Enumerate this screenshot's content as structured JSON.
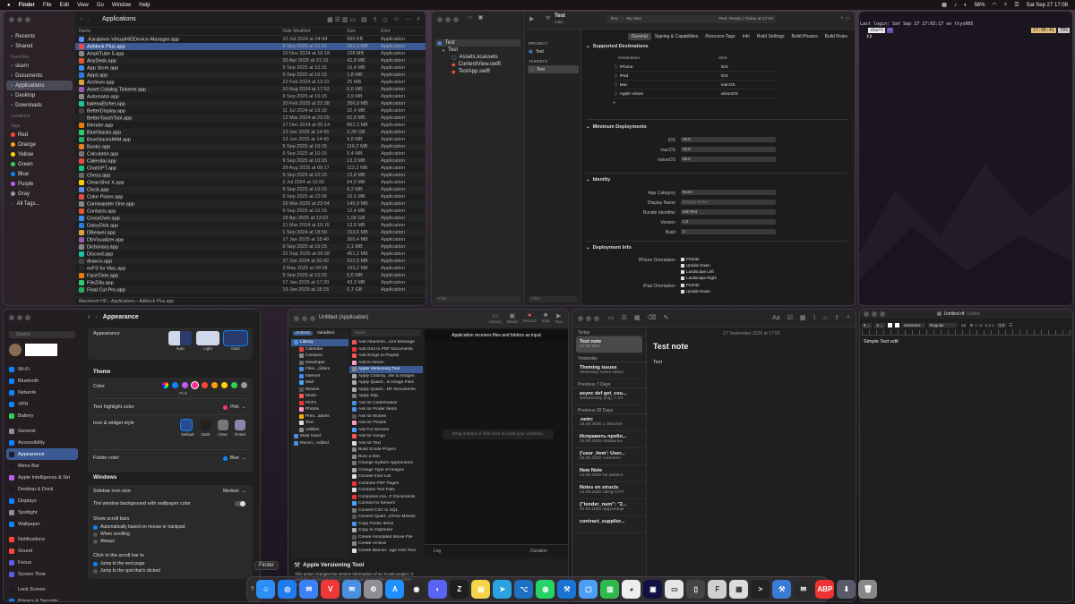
{
  "menubar": {
    "apple": "",
    "app": "Finder",
    "items": [
      "File",
      "Edit",
      "View",
      "Go",
      "Window",
      "Help"
    ],
    "battery": "56%",
    "clock": "Sat Sep 27  17:08"
  },
  "finder": {
    "title": "Applications",
    "sidebar": [
      {
        "h": "",
        "items": [
          {
            "label": "Recents",
            "icon": "clock-icon"
          },
          {
            "label": "Shared",
            "icon": "folder-shared-icon"
          }
        ]
      },
      {
        "h": "Favorites",
        "items": [
          {
            "label": "skarn",
            "icon": "home-icon"
          },
          {
            "label": "Documents",
            "icon": "document-icon"
          },
          {
            "label": "Applications",
            "icon": "apps-icon",
            "sel": true
          },
          {
            "label": "Desktop",
            "icon": "desktop-icon"
          },
          {
            "label": "Downloads",
            "icon": "download-icon"
          }
        ]
      },
      {
        "h": "Locations",
        "items": []
      },
      {
        "h": "Tags",
        "items": [
          {
            "label": "Red",
            "color": "#ff453a"
          },
          {
            "label": "Orange",
            "color": "#ff9f0a"
          },
          {
            "label": "Yellow",
            "color": "#ffd60a"
          },
          {
            "label": "Green",
            "color": "#30d158"
          },
          {
            "label": "Blue",
            "color": "#0a84ff"
          },
          {
            "label": "Purple",
            "color": "#bf5af2"
          },
          {
            "label": "Gray",
            "color": "#98989d"
          },
          {
            "label": "All Tags...",
            "color": ""
          }
        ]
      }
    ],
    "columns": [
      "Name",
      "Date Modified",
      "Size",
      "Kind"
    ],
    "rows": [
      [
        ".Karabiner-VirtualHIDDevice-Manager.app",
        "10 Jul 2024 at 14:44",
        "999 KB",
        "Application"
      ],
      [
        "Adblock Plus.app",
        "9 Sep 2025 at 10:15",
        "351,3 MB",
        "Application"
      ],
      [
        "AmpliTube 5.app",
        "10 Nov 2024 at 15:18",
        "108 MB",
        "Application"
      ],
      [
        "AnyDesk.app",
        "30 Apr 2025 at 21:16",
        "42,8 MB",
        "Application"
      ],
      [
        "App Store.app",
        "9 Sep 2025 at 10:15",
        "16,4 MB",
        "Application"
      ],
      [
        "Apps.app",
        "9 Sep 2025 at 10:15",
        "1,8 MB",
        "Application"
      ],
      [
        "Archiver.app",
        "22 Feb 2024 at 13:22",
        "25 MB",
        "Application"
      ],
      [
        "Asset Catalog Tinkerer.app",
        "10 Aug 2024 at 17:53",
        "6,6 MB",
        "Application"
      ],
      [
        "Automator.app",
        "9 Sep 2025 at 10:15",
        "3,9 MB",
        "Application"
      ],
      [
        "balenaEtcher.app",
        "20 Feb 2025 at 22:38",
        "366,9 MB",
        "Application"
      ],
      [
        "BetterDisplay.app",
        "11 Jul 2024 at 19:30",
        "32,4 MB",
        "Application"
      ],
      [
        "BetterTouchTool.app",
        "12 Mar 2024 at 23:25",
        "92,9 MB",
        "Application"
      ],
      [
        "Blender.app",
        "17 Dec 2024 at 05:14",
        "862,3 MB",
        "Application"
      ],
      [
        "BlueStacks.app",
        "13 Jun 2025 at 14:43",
        "2,38 GB",
        "Application"
      ],
      [
        "BlueStacksMIM.app",
        "13 Jun 2025 at 14:43",
        "9,8 MB",
        "Application"
      ],
      [
        "Books.app",
        "9 Sep 2025 at 10:15",
        "116,2 MB",
        "Application"
      ],
      [
        "Calculator.app",
        "9 Sep 2025 at 10:15",
        "5,4 MB",
        "Application"
      ],
      [
        "Calendar.app",
        "9 Sep 2025 at 10:15",
        "13,3 MB",
        "Application"
      ],
      [
        "ChatGPT.app",
        "29 Aug 2025 at 09:17",
        "112,2 MB",
        "Application"
      ],
      [
        "Chess.app",
        "9 Sep 2025 at 10:15",
        "13,8 MB",
        "Application"
      ],
      [
        "CleanShot X.app",
        "2 Jul 2024 at 15:50",
        "64,9 MB",
        "Application"
      ],
      [
        "Clock.app",
        "9 Sep 2025 at 10:15",
        "8,2 MB",
        "Application"
      ],
      [
        "Color Picker.app",
        "9 Sep 2025 at 22:06",
        "16,6 MB",
        "Application"
      ],
      [
        "Commander One.app",
        "26 Mar 2025 at 23:54",
        "145,9 MB",
        "Application"
      ],
      [
        "Contacts.app",
        "9 Sep 2025 at 10:15",
        "12,4 MB",
        "Application"
      ],
      [
        "CrossOver.app",
        "18 Apr 2025 at 13:02",
        "1,06 GB",
        "Application"
      ],
      [
        "DaisyDisk.app",
        "21 Mar 2024 at 19:15",
        "13,8 MB",
        "Application"
      ],
      [
        "DBeaver.app",
        "1 Sep 2024 at 18:58",
        "163,6 MB",
        "Application"
      ],
      [
        "DbVisualizer.app",
        "17 Jan 2025 at 18:40",
        "360,4 MB",
        "Application"
      ],
      [
        "Dictionary.app",
        "9 Sep 2025 at 10:15",
        "2,1 MB",
        "Application"
      ],
      [
        "Discord.app",
        "22 Sep 2025 at 09:38",
        "451,2 MB",
        "Application"
      ],
      [
        "draw.io.app",
        "27 Jun 2024 at 20:42",
        "522,5 MB",
        "Application"
      ],
      [
        "exFS for Mac.app",
        "3 May 2025 at 09:28",
        "193,2 MB",
        "Application"
      ],
      [
        "FaceTime.app",
        "9 Sep 2025 at 10:15",
        "5,6 MB",
        "Application"
      ],
      [
        "FileZilla.app",
        "17 Jan 2025 at 17:20",
        "43,3 MB",
        "Application"
      ],
      [
        "Final Cut Pro.app",
        "19 Jan 2025 at 18:15",
        "5,7 GB",
        "Application"
      ]
    ],
    "path": [
      "Macintosh HD",
      "Applications",
      "Adblock Plus.app"
    ]
  },
  "xcode": {
    "project": "Test",
    "branch": "main",
    "scheme": "Test",
    "device": "My Mac",
    "status": "Test: Ready | Today at 17:04",
    "nav": [
      "Test",
      "Test",
      "Assets.xcassets",
      "ContentView.swift",
      "TestApp.swift"
    ],
    "proj_h": "PROJECT",
    "proj": "Test",
    "targets_h": "TARGETS",
    "target": "Test",
    "tabs": [
      "General",
      "Signing & Capabilities",
      "Resource Tags",
      "Info",
      "Build Settings",
      "Build Phases",
      "Build Rules"
    ],
    "sd_title": "Supported Destinations",
    "dest_h": [
      "Destination",
      "SDK"
    ],
    "dests": [
      [
        "iPhone",
        "iOS"
      ],
      [
        "iPad",
        "iOS"
      ],
      [
        "Mac",
        "macOS"
      ],
      [
        "Apple Vision",
        "visionOS"
      ]
    ],
    "md_title": "Minimum Deployments",
    "mins": [
      [
        "iOS",
        "26.0"
      ],
      [
        "macOS",
        "26.0"
      ],
      [
        "visionOS",
        "26.0"
      ]
    ],
    "id_title": "Identity",
    "id_rows": [
      [
        "App Category",
        "None"
      ],
      [
        "Display Name",
        "Display Name"
      ],
      [
        "Bundle Identifier",
        "ssll.Test"
      ],
      [
        "Version",
        "1.0"
      ],
      [
        "Build",
        "1"
      ]
    ],
    "di_title": "Deployment Info",
    "iphone_or": "iPhone Orientation",
    "ipad_or": "iPad Orientation",
    "orients": [
      "Portrait",
      "Upside Down",
      "Landscape Left",
      "Landscape Right"
    ],
    "ipad_orients": [
      "Portrait",
      "Upside Down"
    ],
    "filter": "Filter"
  },
  "terminal": {
    "line1": "Last login: Sat Sep 27 17:03:17 on ttys005",
    "prompt": "skarn",
    "time": "17:06:41",
    "pct": "70%",
    "cursor": "❯❯"
  },
  "settings": {
    "title": "Appearance",
    "search": "Search",
    "items": [
      [
        "Wi-Fi",
        "#0a84ff"
      ],
      [
        "Bluetooth",
        "#0a84ff"
      ],
      [
        "Network",
        "#0a84ff"
      ],
      [
        "VPN",
        "#0a84ff"
      ],
      [
        "Battery",
        "#30d158"
      ],
      [
        "General",
        "#8e8e93"
      ],
      [
        "Accessibility",
        "#0a84ff"
      ],
      [
        "Appearance",
        "#1c1c1e"
      ],
      [
        "Menu Bar",
        "#1c1c1e"
      ],
      [
        "Apple Intelligence & Siri",
        "#bf5af2"
      ],
      [
        "Desktop & Dock",
        "#1c1c1e"
      ],
      [
        "Displays",
        "#0a84ff"
      ],
      [
        "Spotlight",
        "#8e8e93"
      ],
      [
        "Wallpaper",
        "#0a84ff"
      ],
      [
        "Notifications",
        "#ff453a"
      ],
      [
        "Sound",
        "#ff453a"
      ],
      [
        "Focus",
        "#5e5ce6"
      ],
      [
        "Screen Time",
        "#5e5ce6"
      ],
      [
        "Lock Screen",
        "#1c1c1e"
      ],
      [
        "Privacy & Security",
        "#0a84ff"
      ]
    ],
    "appearance_label": "Appearance",
    "modes": [
      "Auto",
      "Light",
      "Dark"
    ],
    "theme_h": "Theme",
    "color_label": "Color",
    "color_sel": "Pink",
    "accents": [
      "#8e8e93",
      "#0a84ff",
      "#bf5af2",
      "#ff2d92",
      "#ff453a",
      "#ff9f0a",
      "#ffd60a",
      "#30d158",
      "#98989d"
    ],
    "highlight_label": "Text highlight color",
    "highlight_val": "Pink",
    "icon_style_label": "Icon & widget style",
    "icon_styles": [
      "Default",
      "Dark",
      "Clear",
      "Tinted"
    ],
    "folder_label": "Folder color",
    "folder_val": "Blue",
    "windows_h": "Windows",
    "sidebar_icon": "Sidebar icon size",
    "sidebar_icon_val": "Medium",
    "tint_label": "Tint window background with wallpaper color",
    "scrollbars_label": "Show scroll bars",
    "scroll_opts": [
      "Automatically based on mouse or trackpad",
      "When scrolling",
      "Always"
    ],
    "click_label": "Click in the scroll bar to",
    "click_opts": [
      "Jump to the next page",
      "Jump to the spot that's clicked"
    ]
  },
  "automator": {
    "title": "Untitled (Application)",
    "tools": [
      "Library",
      "Media",
      "Record",
      "Stop",
      "Run"
    ],
    "tabs": [
      "Actions",
      "Variables"
    ],
    "search": "Name",
    "lib": [
      "Library",
      "Calendar",
      "Contacts",
      "Developer",
      "Files...olders",
      "Internet",
      "Mail",
      "Movies",
      "Music",
      "PDFs",
      "Photos",
      "Pres...ations",
      "Text",
      "Utilities",
      "Most Used",
      "Recen...Added"
    ],
    "actions": [
      "Add Attachme...ront Message",
      "Add Grid to PDF Documents",
      "Add Songs to Playlist",
      "Add to Album",
      "Apple Versioning Tool",
      "Apply ColorSy...file to Images",
      "Apply Quartz...to Image Files",
      "Apply Quartz...DF Documents",
      "Apply SQL",
      "Ask for Confirmation",
      "Ask for Finder Items",
      "Ask for Movies",
      "Ask for Photos",
      "Ask For Servers",
      "Ask for Songs",
      "Ask for Text",
      "Build Xcode Project",
      "Burn a Disc",
      "Change System Appearance",
      "Change Type of Images",
      "Choose from List",
      "Combine PDF Pages",
      "Combine Text Files",
      "Compress ima...F Documents",
      "Connect to Servers",
      "Convert CSV to SQL",
      "Convert Quart...kTime Movies",
      "Copy Finder Items",
      "Copy to Clipboard",
      "Create Annotated Movie File",
      "Create Archive",
      "Create Banner...age from Text"
    ],
    "receives": "Application receives files and folders as input",
    "drag": "Drag actions or files here to build your workflow.",
    "log": "Log",
    "duration": "Duration",
    "desc_title": "Apple Versioning Tool",
    "desc": "This action changes the version information of an Xcode project. It uses the agvtool shell tool, and can set most of the options of that tool."
  },
  "notes": {
    "today": "Today",
    "yesterday": "Yesterday",
    "prev7": "Previous 7 Days",
    "prev30": "Previous 30 Days",
    "items": [
      {
        "t": "Test note",
        "s": "17:05  Text",
        "sec": "today"
      },
      {
        "t": "Theming issues",
        "s": "Yesterday  Notes select",
        "sec": "yesterday"
      },
      {
        "t": "async def get_cou...",
        "s": "Wednesday  [int]) -> int",
        "sec": "prev7"
      },
      {
        "t": ".netrc",
        "s": "18.09.2025  1 ottochne",
        "sec": "prev30"
      },
      {
        "t": "Исправить пробл...",
        "s": "15.09.2025  Нормальн",
        "sec": "prev30"
      },
      {
        "t": "{'user_item': User...",
        "s": "15.09.2025  'commerc",
        "sec": "prev30"
      },
      {
        "t": "New Note",
        "s": "14.09.2025  No additior",
        "sec": "prev30"
      },
      {
        "t": "Notes on structs",
        "s": "13.09.2025  Using CFFI",
        "sec": "prev30"
      },
      {
        "t": "{\"tender_num\": \"2...",
        "s": "01.09.2025  /app/ordeje",
        "sec": "prev30"
      },
      {
        "t": "contract_supplier...",
        "s": "",
        "sec": "prev30"
      }
    ],
    "date": "27 September 2025 at 17:05",
    "body_title": "Test note",
    "body": "Text"
  },
  "textedit": {
    "title": "Untitled.rtf",
    "edited": "Edited",
    "font": "Helvetica",
    "style": "Regular",
    "size": "12",
    "spacing": "1,0",
    "body": "Simple Text edit"
  },
  "dock": {
    "tooltip": "Finder",
    "apps": [
      [
        "Finder",
        "#2d8ef5"
      ],
      [
        "Safari",
        "#1e7cf0"
      ],
      [
        "Mail",
        "#3b82f6"
      ],
      [
        "Vivaldi",
        "#ef3939"
      ],
      [
        "Mail",
        "#4a90e2"
      ],
      [
        "System Settings",
        "#8e8e93"
      ],
      [
        "App Store",
        "#1e90ff"
      ],
      [
        "Arc",
        "#2a2a2a"
      ],
      [
        "Discord",
        "#5865f2"
      ],
      [
        "Zed",
        "#1e1e1e"
      ],
      [
        "Notes",
        "#f5d547"
      ],
      [
        "Telegram",
        "#2aa3e0"
      ],
      [
        "VS Code",
        "#1f6fc4"
      ],
      [
        "WhatsApp",
        "#25d366"
      ],
      [
        "Xcode",
        "#1a74d6"
      ],
      [
        "Pages",
        "#4a9ef5"
      ],
      [
        "Numbers",
        "#30b94d"
      ],
      [
        "GitHub",
        "#eeeeee"
      ],
      [
        "Finder",
        "#111144"
      ],
      [
        "Preview",
        "#e5e5e5"
      ],
      [
        "Tablet",
        "#444444"
      ],
      [
        "Font Book",
        "#d0d0d0"
      ],
      [
        "BTT",
        "#dddddd"
      ],
      [
        "Terminal",
        "#222222"
      ],
      [
        "Xcode",
        "#3a7bd5"
      ],
      [
        "Mail",
        "#2a2a2a"
      ],
      [
        "AdBlock",
        "#e33"
      ],
      [
        "Downloads",
        "#5a5a6a"
      ],
      [
        "Trash",
        "#888"
      ]
    ]
  }
}
